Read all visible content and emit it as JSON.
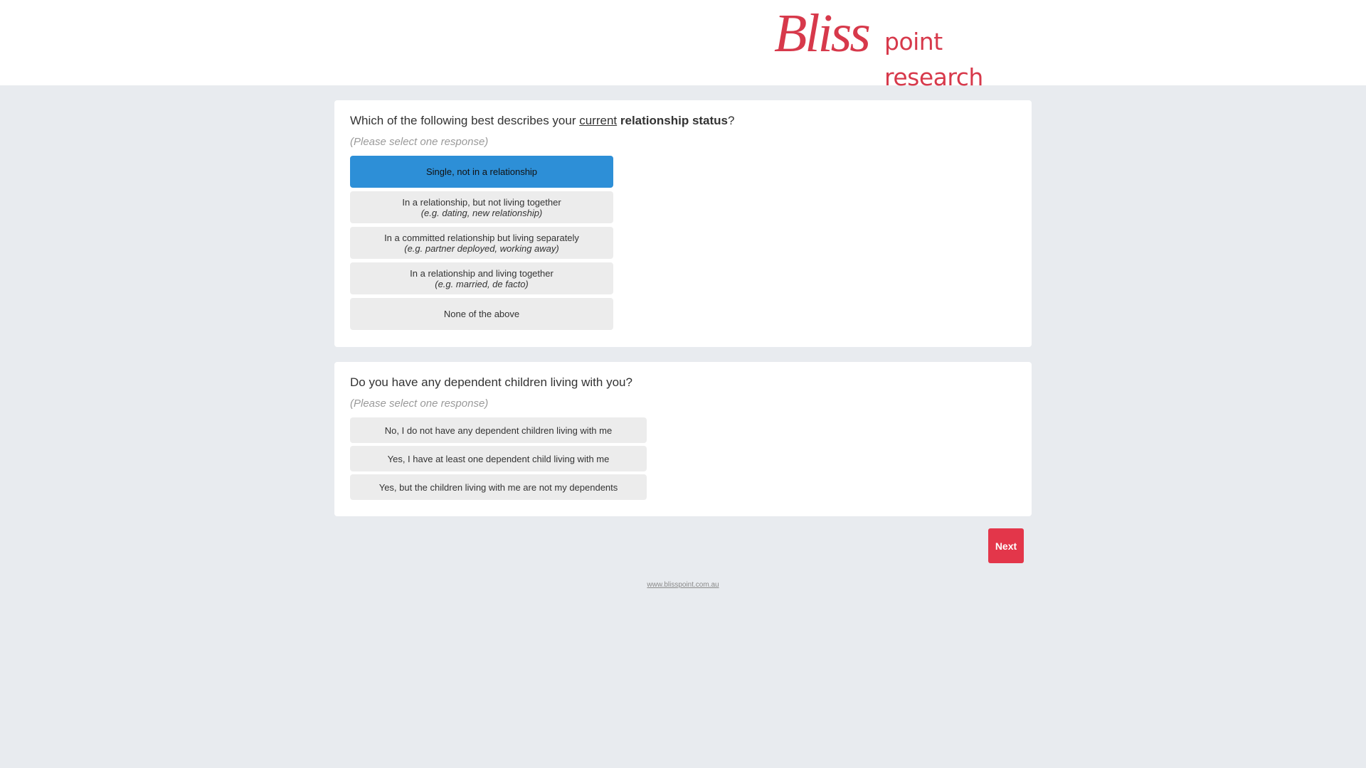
{
  "brand": {
    "script": "Bliss",
    "subtitle": "point research",
    "color": "#d7394b"
  },
  "question1": {
    "prefix": "Which of the following best describes your ",
    "underlined": "current",
    "bold": "relationship status",
    "suffix": "?",
    "hint": "(Please select one response)",
    "options": [
      {
        "label": "Single, not in a relationship",
        "sub": "",
        "selected": true
      },
      {
        "label": "In a relationship, but not living together",
        "sub": "(e.g. dating, new relationship)",
        "selected": false
      },
      {
        "label": "In a committed relationship but living separately",
        "sub": "(e.g. partner deployed, working away)",
        "selected": false
      },
      {
        "label": "In a relationship and living together",
        "sub": "(e.g. married, de facto)",
        "selected": false
      },
      {
        "label": "None of the above",
        "sub": "",
        "selected": false
      }
    ]
  },
  "question2": {
    "title": "Do you have any dependent children living with you?",
    "hint": "(Please select one response)",
    "options": [
      {
        "label": "No, I do not have any dependent children living with me",
        "selected": false
      },
      {
        "label": "Yes, I have at least one dependent child living with me",
        "selected": false
      },
      {
        "label": "Yes, but the children living with me are not my dependents",
        "selected": false
      }
    ]
  },
  "next_label": "Next",
  "footer_link": "www.blisspoint.com.au",
  "colors": {
    "selected": "#2d8fd7",
    "option_bg": "#ececec",
    "next_button": "#e3364a",
    "page_bg": "#e8ebef"
  }
}
